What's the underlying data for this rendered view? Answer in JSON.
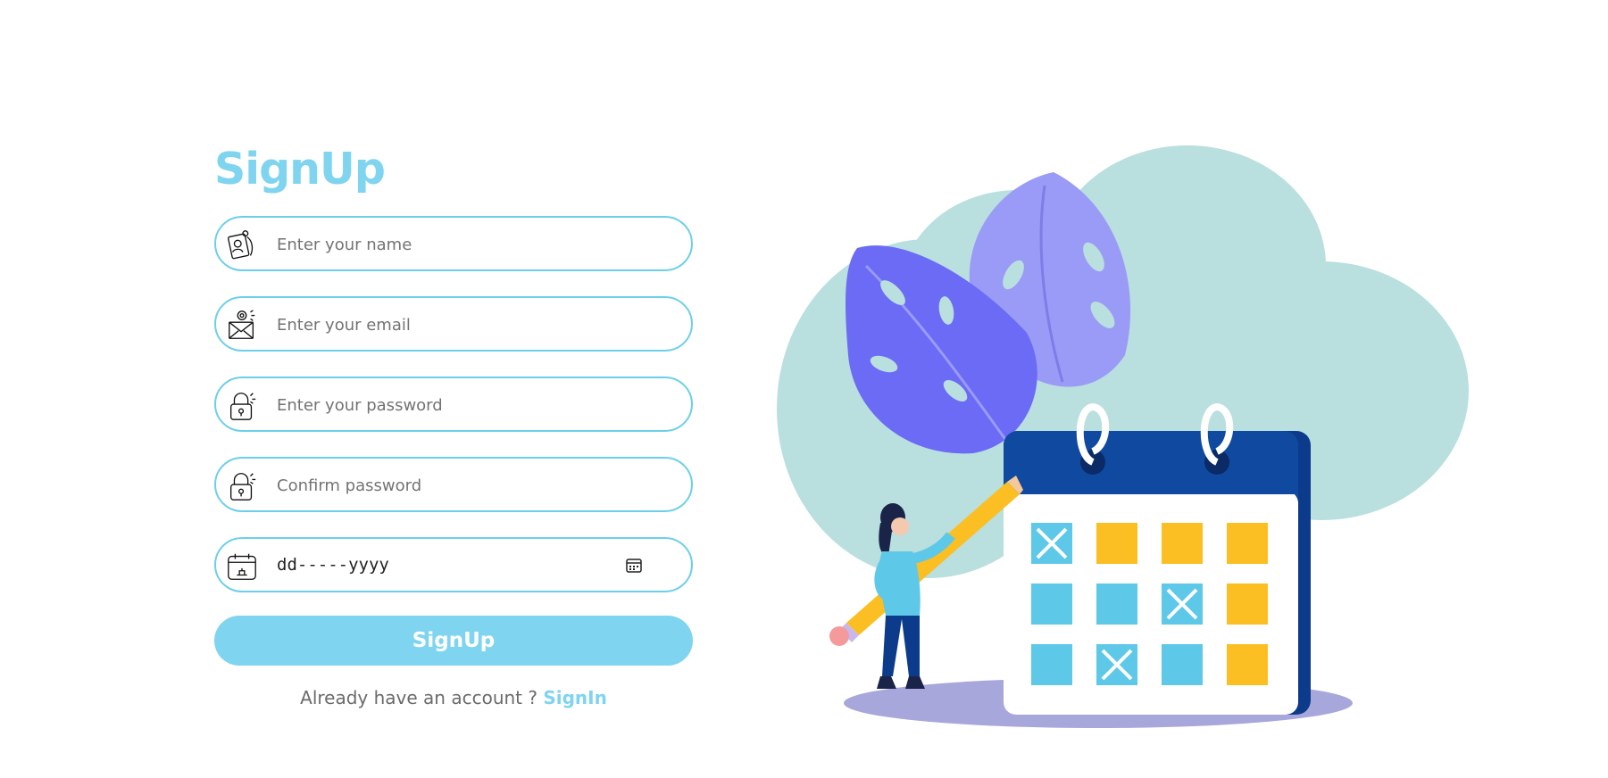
{
  "form": {
    "title": "SignUp",
    "fields": [
      {
        "icon": "id-badge-icon",
        "placeholder": "Enter your name",
        "type": "text"
      },
      {
        "icon": "mail-icon",
        "placeholder": "Enter your email",
        "type": "email"
      },
      {
        "icon": "lock-icon",
        "placeholder": "Enter your password",
        "type": "password"
      },
      {
        "icon": "lock-icon",
        "placeholder": "Confirm password",
        "type": "password"
      }
    ],
    "date_field": {
      "icon": "calendar-icon",
      "value": "dd-----yyyy",
      "picker_icon": "calendar-picker-icon"
    },
    "submit_label": "SignUp",
    "signin_prompt": "Already have an account ?",
    "signin_link": "SignIn"
  },
  "illustration": {
    "name": "calendar-planning-illustration"
  },
  "colors": {
    "accent": "#7fd4f0",
    "field_border": "#6ccfea",
    "navy": "#0d3b8c",
    "yellow": "#fbbf24",
    "cyan": "#5ec8e8",
    "leaf": "#6b6bf5",
    "cloud": "#b9dfdf"
  }
}
